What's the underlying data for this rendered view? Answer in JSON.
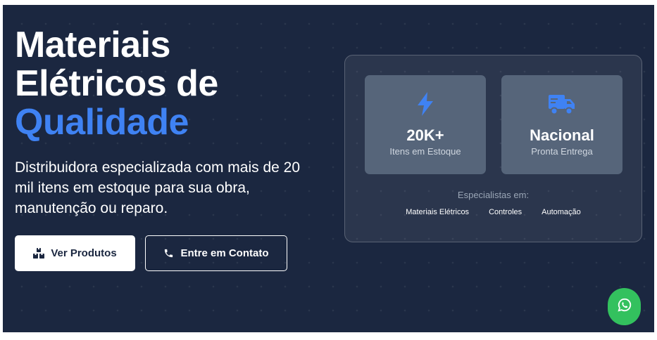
{
  "hero": {
    "headline_line1": "Materiais",
    "headline_line2": "Elétricos de",
    "headline_accent": "Qualidade",
    "subtitle": "Distribuidora especializada com mais de 20 mil itens em estoque para sua obra, manutenção ou reparo.",
    "primary_button": {
      "label": "Ver Produtos",
      "icon": "boxes-icon"
    },
    "secondary_button": {
      "label": "Entre em Contato",
      "icon": "phone-icon"
    }
  },
  "stats": [
    {
      "value": "20K+",
      "label": "Itens em Estoque",
      "icon": "lightning-bolt-icon"
    },
    {
      "value": "Nacional",
      "label": "Pronta Entrega",
      "icon": "delivery-truck-icon"
    }
  ],
  "specialties": {
    "title": "Especialistas em:",
    "items": [
      "Materiais Elétricos",
      "Controles",
      "Automação"
    ]
  },
  "whatsapp": {
    "icon": "whatsapp-icon"
  },
  "colors": {
    "background": "#1b2740",
    "accent": "#3f82f3",
    "card": "#56657a",
    "whatsapp": "#33c15e"
  }
}
